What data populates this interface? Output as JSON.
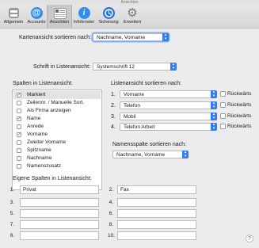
{
  "window": {
    "title": "Ansichten"
  },
  "toolbar": {
    "items": [
      {
        "label": "Allgemein"
      },
      {
        "label": "Accounts"
      },
      {
        "label": "Ansichten"
      },
      {
        "label": "Infofenster"
      },
      {
        "label": "Sicherung"
      },
      {
        "label": "Erweitert"
      }
    ]
  },
  "card_sort": {
    "label": "Kartenansicht sortieren nach:",
    "value": "Nachname, Vorname"
  },
  "font": {
    "label": "Schrift in Listenansicht:",
    "value": "Systemschrift 12"
  },
  "columns": {
    "heading": "Spalten in Listenansicht:",
    "items": [
      {
        "label": "Markiert",
        "checked": true,
        "selected": true
      },
      {
        "label": "Zeilennr. / Manuelle Sort.",
        "checked": false
      },
      {
        "label": "Als Firma anzeigen",
        "checked": false
      },
      {
        "label": "Name",
        "checked": true
      },
      {
        "label": "Anrede",
        "checked": false
      },
      {
        "label": "Vorname",
        "checked": true
      },
      {
        "label": "Zweiter Vorname",
        "checked": false
      },
      {
        "label": "Spitzname",
        "checked": false
      },
      {
        "label": "Nachname",
        "checked": false
      },
      {
        "label": "Namenszusatz",
        "checked": false
      }
    ]
  },
  "list_sort": {
    "heading": "Listenansicht sortieren nach:",
    "rows": [
      {
        "num": "1.",
        "value": "Vorname",
        "desc_label": "Rückwärts"
      },
      {
        "num": "2.",
        "value": "Telefon",
        "desc_label": "Rückwärts"
      },
      {
        "num": "3.",
        "value": "Mobil",
        "desc_label": "Rückwärts"
      },
      {
        "num": "4.",
        "value": "Telefon Arbeit",
        "desc_label": "Rückwärts"
      }
    ]
  },
  "name_col_sort": {
    "label": "Namensspalte sortieren nach:",
    "value": "Nachname, Vorname"
  },
  "custom_cols": {
    "heading": "Eigene Spalten in Listenansicht:",
    "left": [
      {
        "num": "1.",
        "value": "Privat"
      },
      {
        "num": "3.",
        "value": ""
      },
      {
        "num": "5.",
        "value": ""
      },
      {
        "num": "7.",
        "value": ""
      },
      {
        "num": "9.",
        "value": ""
      }
    ],
    "right": [
      {
        "num": "2.",
        "value": "Fax"
      },
      {
        "num": "4.",
        "value": ""
      },
      {
        "num": "6.",
        "value": ""
      },
      {
        "num": "8.",
        "value": ""
      },
      {
        "num": "10.",
        "value": ""
      }
    ]
  },
  "help": {
    "label": "?"
  }
}
